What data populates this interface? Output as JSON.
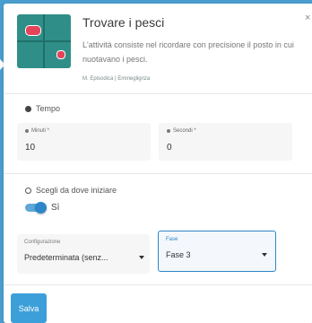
{
  "header": {
    "title": "Trovare i pesci",
    "close_icon": "close-icon",
    "description": "L'attività consiste nel ricordare con precisione il posto in cui nuotavano i pesci.",
    "tags": "M. Episodica | Emineglignza"
  },
  "tempo": {
    "section_label": "Tempo",
    "minutes_label": "Minuti *",
    "minutes_value": "10",
    "seconds_label": "Secondi *",
    "seconds_value": "0"
  },
  "start": {
    "section_label": "Scegli da dove iniziare",
    "toggle_label": "Sì",
    "toggle_on": true,
    "config_label": "Configurazione",
    "config_value": "Predeterminata (senz...",
    "phase_label": "Fase",
    "phase_value": "Fase 3"
  },
  "footer": {
    "save_label": "Salva"
  },
  "colors": {
    "background": "#4a9fd0",
    "accent": "#2d86c9",
    "save_button": "#3d9fd9"
  }
}
